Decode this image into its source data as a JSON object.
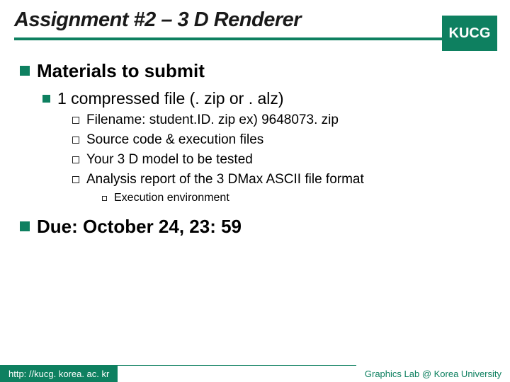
{
  "badge": "KUCG",
  "title": "Assignment #2 – 3 D Renderer",
  "bullets": {
    "materials": {
      "heading": "Materials to submit",
      "sub1": "1 compressed file (. zip or . alz)",
      "items": [
        "Filename: student.ID. zip   ex) 9648073. zip",
        "Source code & execution files",
        "Your 3 D model to be tested",
        "Analysis report of the 3 DMax ASCII file format"
      ],
      "subsub": "Execution environment"
    },
    "due": "Due: October 24, 23: 59"
  },
  "footer": {
    "left": "http: //kucg. korea. ac. kr",
    "right": "Graphics Lab @ Korea University"
  }
}
